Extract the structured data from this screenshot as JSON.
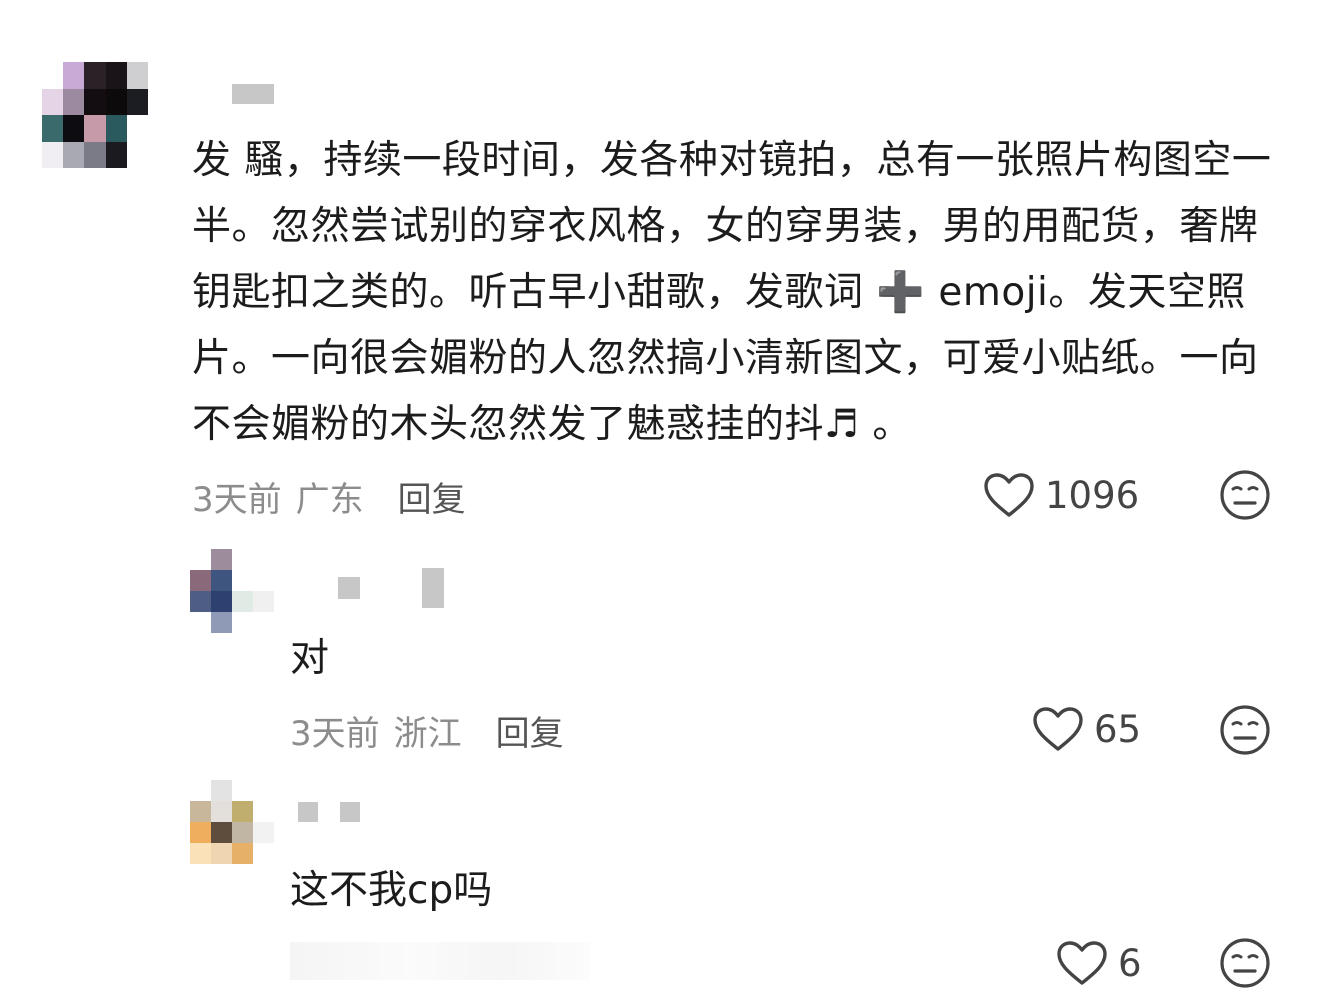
{
  "comments": [
    {
      "id": "main",
      "text": "发 騷，持续一段时间，发各种对镜拍，总有一张照片构图空一半。忽然尝试别的穿衣风格，女的穿男装，男的用配货，奢牌钥匙扣之类的。听古早小甜歌，发歌词 ➕ emoji。发天空照片。一向很会媚粉的人忽然搞小清新图文，可爱小贴纸。一向不会媚粉的木头忽然发了魅惑挂的抖♬ 。",
      "time": "3天前",
      "location": "广东",
      "reply_label": "回复",
      "like_count": "1096",
      "avatar_colors": [
        "#ffffff",
        "#c9a9d6",
        "#2a2226",
        "#1a1418",
        "#cfcfd2",
        "#e5d3e6",
        "#9b8aa0",
        "#130c11",
        "#0d0a0c",
        "#1b1d22",
        "#3a6a6c",
        "#0d0c10",
        "#c79aaa",
        "#2a5a5e",
        "#ffffff",
        "#f0eef2",
        "#a9a9b3",
        "#7b7b88",
        "#1a1a1f",
        "#ffffff"
      ]
    },
    {
      "id": "reply-1",
      "text": "对",
      "time": "3天前",
      "location": "浙江",
      "reply_label": "回复",
      "like_count": "65",
      "avatar_colors": [
        "#ffffff",
        "#9d8c9c",
        "#ffffff",
        "#ffffff",
        "#8a6a7a",
        "#3e5580",
        "#ffffff",
        "#ffffff",
        "#4e5d84",
        "#2e4070",
        "#e1ebe6",
        "#f0f0f0",
        "#ffffff",
        "#8f9ab6",
        "#ffffff",
        "#ffffff"
      ]
    },
    {
      "id": "reply-2",
      "text": "这不我cp吗",
      "time": "",
      "location": "",
      "reply_label": "",
      "like_count": "6",
      "avatar_colors": [
        "#ffffff",
        "#e3e3e3",
        "#ffffff",
        "#ffffff",
        "#c8b79a",
        "#e3e0dc",
        "#bfae6e",
        "#ffffff",
        "#efad5e",
        "#5e4d3c",
        "#c0b6a3",
        "#f2f2f2",
        "#fbe1b8",
        "#f0d6b0",
        "#e7b068",
        "#ffffff"
      ]
    }
  ],
  "icons": {
    "like": "heart-outline-icon",
    "reaction": "neutral-face-icon"
  },
  "colors": {
    "meta": "#8c8c8c",
    "reply": "#555555",
    "icon": "#444444"
  }
}
